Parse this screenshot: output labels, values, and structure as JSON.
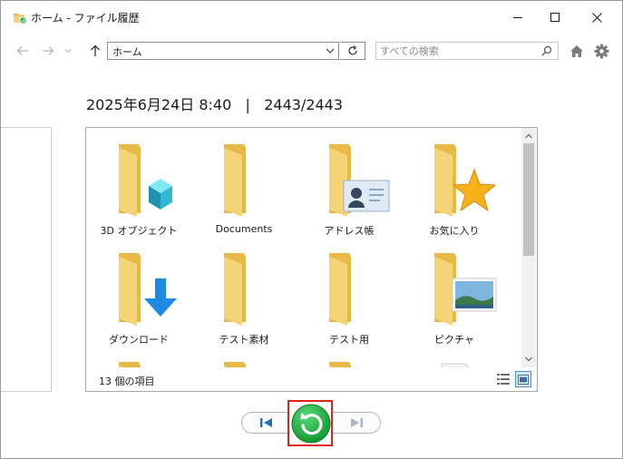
{
  "window": {
    "title": "ホーム - ファイル履歴",
    "icon": "file-history-icon"
  },
  "nav": {
    "back_icon": "arrow-left-icon",
    "forward_icon": "arrow-right-icon",
    "history_icon": "chevron-down-icon",
    "up_icon": "arrow-up-icon",
    "address": "ホーム",
    "refresh_icon": "refresh-icon",
    "search_placeholder": "すべての検索",
    "home_icon": "home-icon",
    "settings_icon": "gear-icon"
  },
  "snapshot": {
    "datetime": "2025年6月24日 8:40",
    "separator": "|",
    "position": "2443/2443"
  },
  "items": [
    {
      "label": "3D オブジェクト",
      "overlay": "cube"
    },
    {
      "label": "Documents",
      "overlay": "none"
    },
    {
      "label": "アドレス帳",
      "overlay": "contact-card"
    },
    {
      "label": "お気に入り",
      "overlay": "star"
    },
    {
      "label": "ダウンロード",
      "overlay": "down-arrow"
    },
    {
      "label": "テスト素材",
      "overlay": "none"
    },
    {
      "label": "テスト用",
      "overlay": "none"
    },
    {
      "label": "ピクチャ",
      "overlay": "landscape"
    }
  ],
  "status": {
    "item_count": "13 個の項目"
  },
  "colors": {
    "folder": "#f5d377",
    "folder_back": "#e9b948",
    "restore_green": "#22b14c",
    "highlight_red": "#e0201b",
    "accent_blue": "#1e88e5"
  }
}
